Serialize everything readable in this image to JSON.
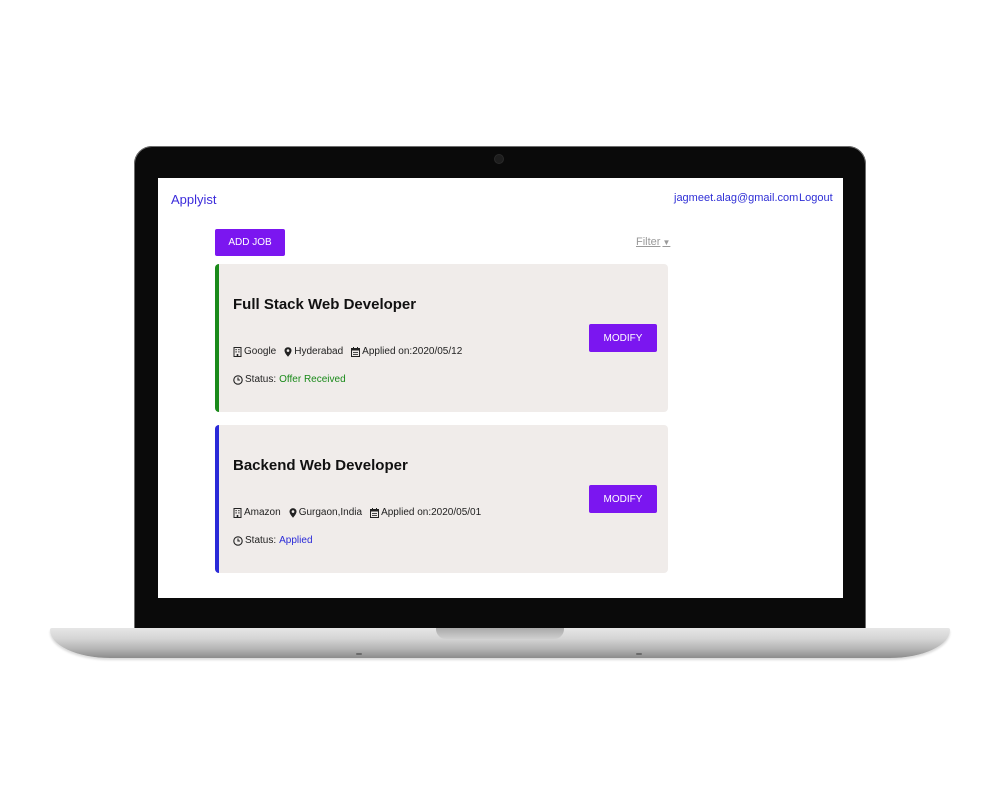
{
  "app": {
    "brand": "Applyist",
    "user_email": "jagmeet.alag@gmail.com",
    "logout_label": "Logout"
  },
  "toolbar": {
    "add_job_label": "ADD JOB",
    "filter_label": "Filter"
  },
  "colors": {
    "accent": "#7b16f0",
    "offer_received": "#1a8a1a",
    "applied": "#2a2ad8"
  },
  "jobs": [
    {
      "title": "Full Stack Web Developer",
      "company": "Google",
      "location": "Hyderabad",
      "applied_on": "Applied on:2020/05/12",
      "status_label": "Status:",
      "status": "Offer Received",
      "status_color": "#1a8a1a",
      "modify_label": "MODIFY"
    },
    {
      "title": "Backend Web Developer",
      "company": "Amazon",
      "location": "Gurgaon,India",
      "applied_on": "Applied on:2020/05/01",
      "status_label": "Status:",
      "status": "Applied",
      "status_color": "#2a2ad8",
      "modify_label": "MODIFY"
    }
  ]
}
